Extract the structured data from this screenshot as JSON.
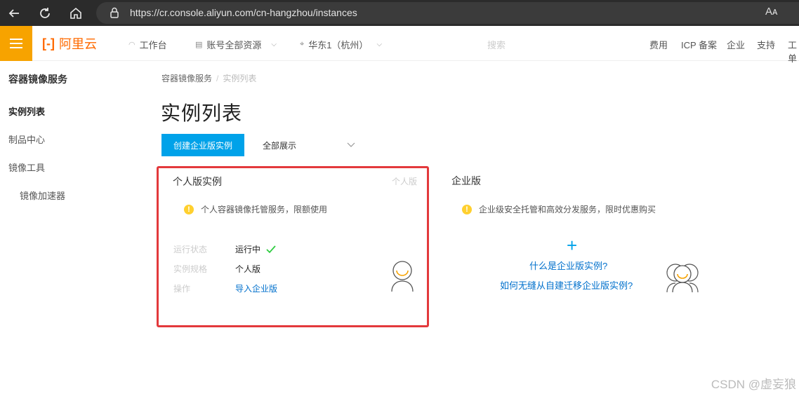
{
  "browser": {
    "url": "https://cr.console.aliyun.com/cn-hangzhou/instances",
    "reader_label": "Aᴀ"
  },
  "header": {
    "logo_mark": "[-]",
    "logo_text": "阿里云",
    "workbench": "工作台",
    "account_resources": "账号全部资源",
    "region": "华东1（杭州）",
    "search_placeholder": "搜索",
    "right_items": [
      "费用",
      "ICP 备案",
      "企业",
      "支持",
      "工单"
    ]
  },
  "sidebar": {
    "title": "容器镜像服务",
    "items": [
      {
        "label": "实例列表",
        "active": true
      },
      {
        "label": "制品中心"
      },
      {
        "label": "镜像工具"
      },
      {
        "label": "镜像加速器",
        "indent": true
      }
    ]
  },
  "main": {
    "breadcrumb": [
      "容器镜像服务",
      "实例列表"
    ],
    "title": "实例列表",
    "create_button": "创建企业版实例",
    "filter": "全部展示"
  },
  "personal_card": {
    "title": "个人版实例",
    "tag": "个人版",
    "notice": "个人容器镜像托管服务，限额使用",
    "rows": [
      {
        "label": "运行状态",
        "value": "运行中"
      },
      {
        "label": "实例规格",
        "value": "个人版"
      },
      {
        "label": "操作",
        "value": "导入企业版"
      }
    ]
  },
  "enterprise_card": {
    "title": "企业版",
    "notice": "企业级安全托管和高效分发服务，限时优惠购买",
    "plus": "+",
    "link1": "什么是企业版实例?",
    "link2": "如何无缝从自建迁移企业版实例?"
  },
  "watermark": "CSDN @虚妄狼",
  "colors": {
    "accent": "#00a2e9",
    "brand": "#ff6a00",
    "menu": "#f7a300",
    "highlight_border": "#e3393c",
    "link": "#0070cc",
    "warning": "#ffd02f",
    "success": "#2ecc40"
  }
}
